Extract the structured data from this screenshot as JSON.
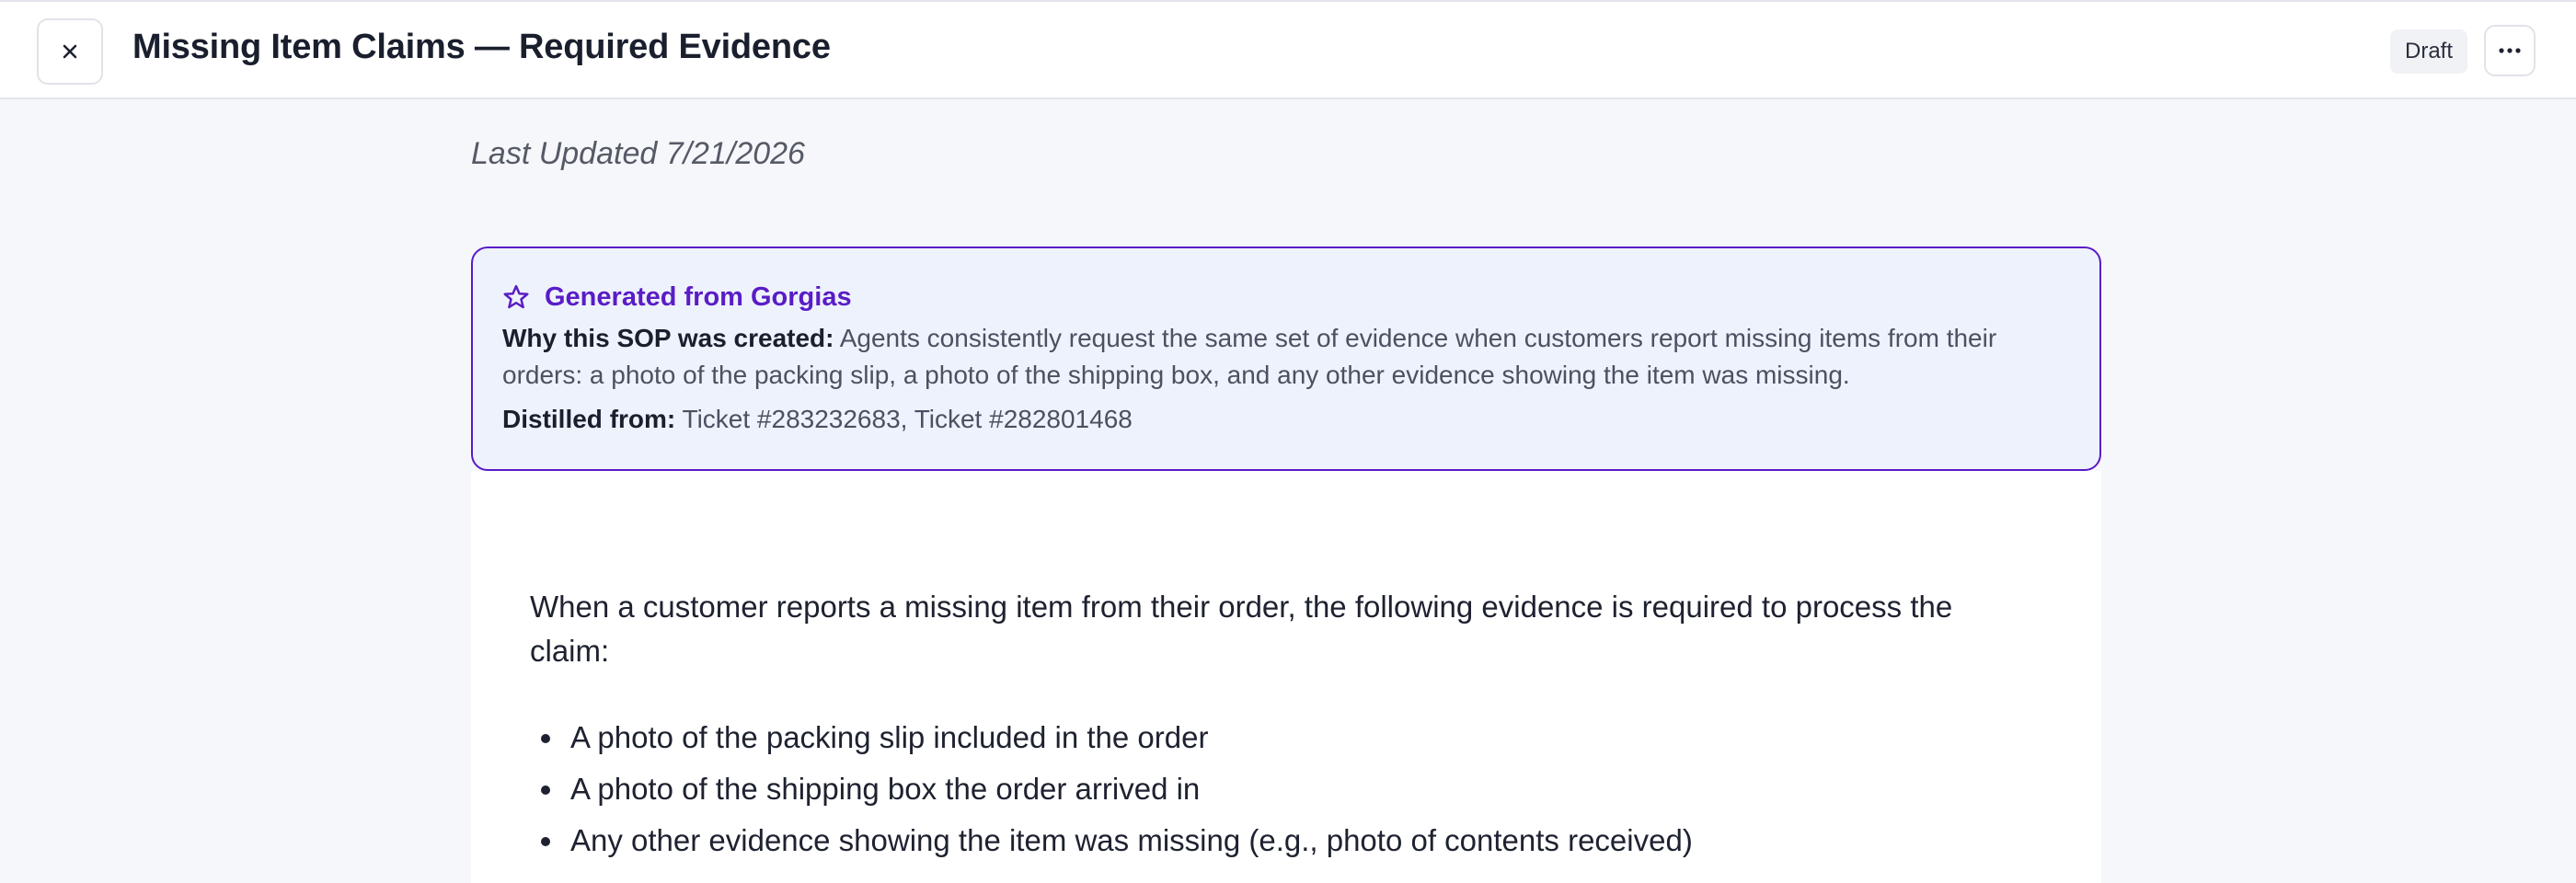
{
  "header": {
    "title": "Missing Item Claims — Required Evidence",
    "status_badge": "Draft",
    "close_icon": "close-icon",
    "more_icon": "more-horizontal-icon"
  },
  "last_updated": "Last Updated 7/21/2026",
  "info_card": {
    "icon": "star-icon",
    "title": "Generated from Gorgias",
    "why_label": "Why this SOP was created:",
    "why_text": " Agents consistently request the same set of evidence when customers report missing items from their orders: a photo of the packing slip, a photo of the shipping box, and any other evidence showing the item was missing.",
    "distilled_label": "Distilled from:",
    "distilled_text": " Ticket #283232683, Ticket #282801468",
    "accent_color": "#5a1cc6"
  },
  "content": {
    "intro": "When a customer reports a missing item from their order, the following evidence is required to process the claim:",
    "evidence_items": [
      "A photo of the packing slip included in the order",
      "A photo of the shipping box the order arrived in",
      "Any other evidence showing the item was missing (e.g., photo of contents received)"
    ]
  }
}
